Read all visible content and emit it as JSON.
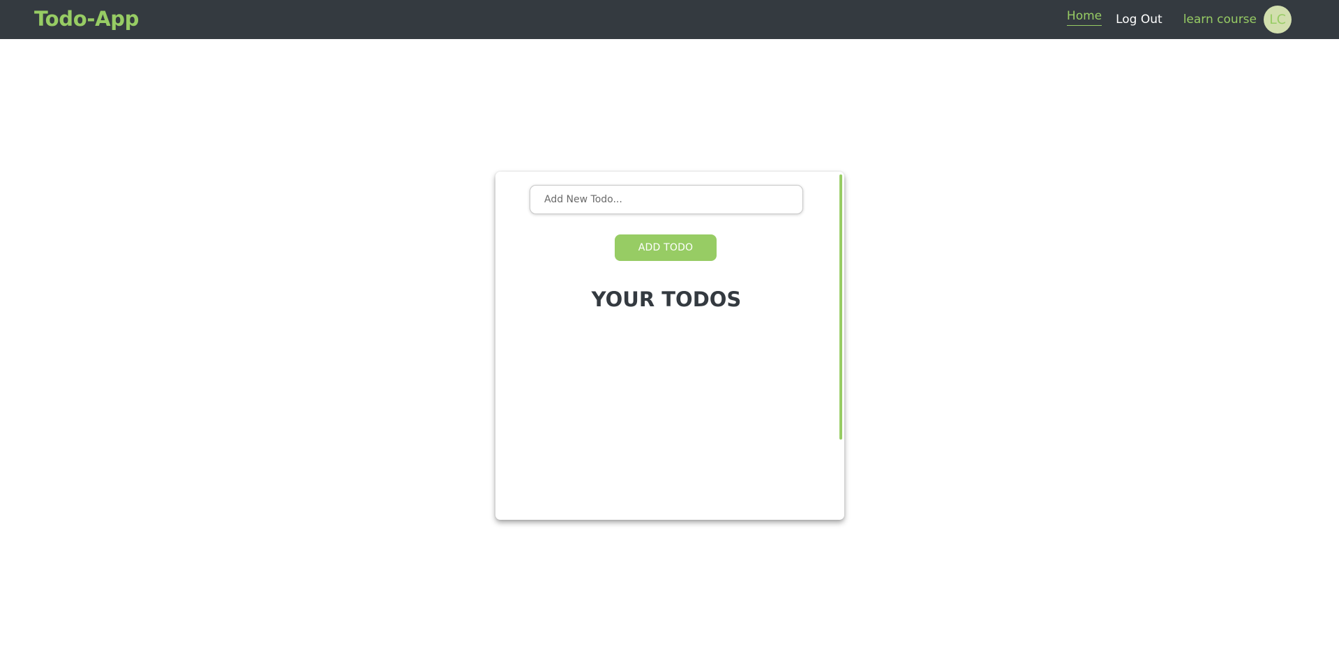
{
  "navbar": {
    "brand": "Todo-App",
    "links": {
      "home": "Home",
      "logout": "Log Out"
    },
    "user": {
      "name": "learn course",
      "initials": "LC"
    }
  },
  "main": {
    "input_placeholder": "Add New Todo...",
    "input_value": "",
    "add_button_label": "ADD TODO",
    "section_title": "YOUR TODOS",
    "todos": []
  },
  "colors": {
    "navbar_bg": "#343a40",
    "accent": "#97cc64",
    "avatar_bg": "#d2dfae",
    "title_text": "#343a40"
  }
}
